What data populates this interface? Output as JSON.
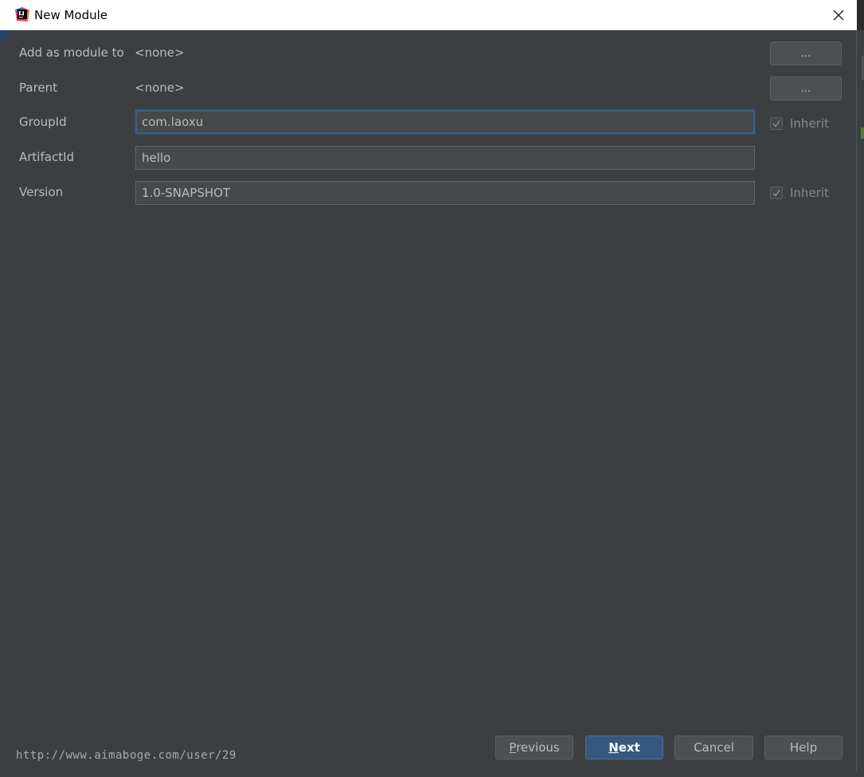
{
  "window": {
    "title": "New Module"
  },
  "form": {
    "add_as_module": {
      "label": "Add as module to",
      "value": "<none>",
      "browse_label": "..."
    },
    "parent": {
      "label": "Parent",
      "value": "<none>",
      "browse_label": "..."
    },
    "group_id": {
      "label": "GroupId",
      "value": "com.laoxu",
      "inherit_label": "Inherit",
      "inherit_checked": true
    },
    "artifact_id": {
      "label": "ArtifactId",
      "value": "hello"
    },
    "version": {
      "label": "Version",
      "value": "1.0-SNAPSHOT",
      "inherit_label": "Inherit",
      "inherit_checked": true
    }
  },
  "footer": {
    "watermark": "http://www.aimaboge.com/user/29",
    "buttons": {
      "previous_first": "P",
      "previous_rest": "revious",
      "next_first": "N",
      "next_rest": "ext",
      "cancel": "Cancel",
      "help": "Help"
    }
  },
  "colors": {
    "background": "#3c3f41",
    "input_bg": "#45494a",
    "focus_border": "#3d6185",
    "primary_button": "#365880",
    "text": "#bbbbbb"
  },
  "icons": {
    "app": "intellij-idea-icon",
    "close": "close-icon",
    "check": "checkmark-icon"
  }
}
